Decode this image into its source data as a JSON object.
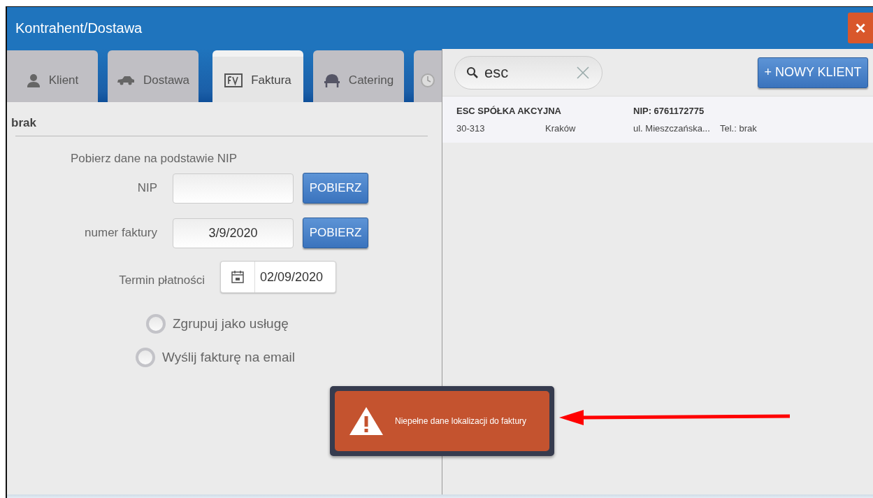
{
  "window": {
    "title": "Kontrahent/Dostawa",
    "close_label": "×"
  },
  "tabs": [
    {
      "label": "Klient",
      "selected": false
    },
    {
      "label": "Dostawa",
      "selected": false
    },
    {
      "label": "Faktura",
      "selected": true
    },
    {
      "label": "Catering",
      "selected": false
    },
    {
      "selected": false
    }
  ],
  "client_name": "brak",
  "nip_section": {
    "heading": "Pobierz dane na podstawie NIP",
    "rows": [
      {
        "label": "NIP",
        "button": "POBIERZ"
      },
      {
        "label": "numer faktury",
        "value": "3/9/2020",
        "button": "POBIERZ"
      }
    ]
  },
  "due_date": {
    "label": "Termin płatności",
    "value": "02/09/2020"
  },
  "options": [
    {
      "label": "Zgrupuj jako usługę",
      "checked": false
    },
    {
      "label": "Wyślij fakturę na email",
      "checked": false
    }
  ],
  "search": {
    "value": "esc"
  },
  "new_client_button": "+ NOWY KLIENT",
  "results": [
    {
      "name": "ESC SPÓŁKA AKCYJNA",
      "nip": "NIP: 6761172775",
      "postal_code": "30-313",
      "city": "Kraków",
      "street": "ul. Mieszczańska...",
      "phone": "Tel.: brak"
    }
  ],
  "toast": {
    "message": "Niepełne dane lokalizacji do faktury"
  }
}
